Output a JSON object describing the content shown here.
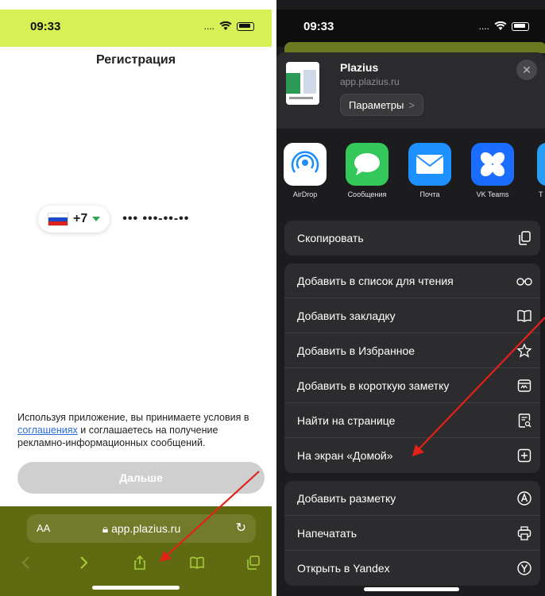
{
  "left": {
    "status": {
      "time": "09:33"
    },
    "title": "Регистрация",
    "phone": {
      "code": "+7",
      "mask": "••• •••-••-••"
    },
    "terms": {
      "part1": "Используя приложение, вы принимаете условия в ",
      "link": "соглашениях",
      "part2": " и соглашаетесь на получение рекламно-информационных сообщений."
    },
    "next_button": "Дальше",
    "browser": {
      "aa": "AA",
      "url": "app.plazius.ru"
    }
  },
  "right": {
    "status": {
      "time": "09:33"
    },
    "share_header": {
      "app_name": "Plazius",
      "app_url": "app.plazius.ru",
      "params_label": "Параметры",
      "params_chevron": ">"
    },
    "apps": [
      {
        "label": "AirDrop",
        "icon": "airdrop-icon"
      },
      {
        "label": "Сообщения",
        "icon": "messages-icon"
      },
      {
        "label": "Почта",
        "icon": "mail-icon"
      },
      {
        "label": "VK Teams",
        "icon": "vk-teams-icon"
      },
      {
        "label": "T",
        "icon": "partial-app-icon"
      }
    ],
    "actions_group1": [
      {
        "label": "Скопировать",
        "icon": "copy-icon"
      }
    ],
    "actions_group2": [
      {
        "label": "Добавить в список для чтения",
        "icon": "glasses-icon"
      },
      {
        "label": "Добавить закладку",
        "icon": "book-icon"
      },
      {
        "label": "Добавить в Избранное",
        "icon": "star-icon"
      },
      {
        "label": "Добавить в короткую заметку",
        "icon": "quick-note-icon"
      },
      {
        "label": "Найти на странице",
        "icon": "find-on-page-icon"
      },
      {
        "label": "На экран «Домой»",
        "icon": "add-to-home-icon"
      }
    ],
    "actions_group3": [
      {
        "label": "Добавить разметку",
        "icon": "markup-icon"
      },
      {
        "label": "Напечатать",
        "icon": "print-icon"
      },
      {
        "label": "Открыть в Yandex",
        "icon": "yandex-icon"
      }
    ]
  },
  "colors": {
    "brand_lime": "#d6f055",
    "browser_bar": "#5f6a11",
    "arrow": "#e32119",
    "toolbar_icon": "#a9cf3a"
  }
}
